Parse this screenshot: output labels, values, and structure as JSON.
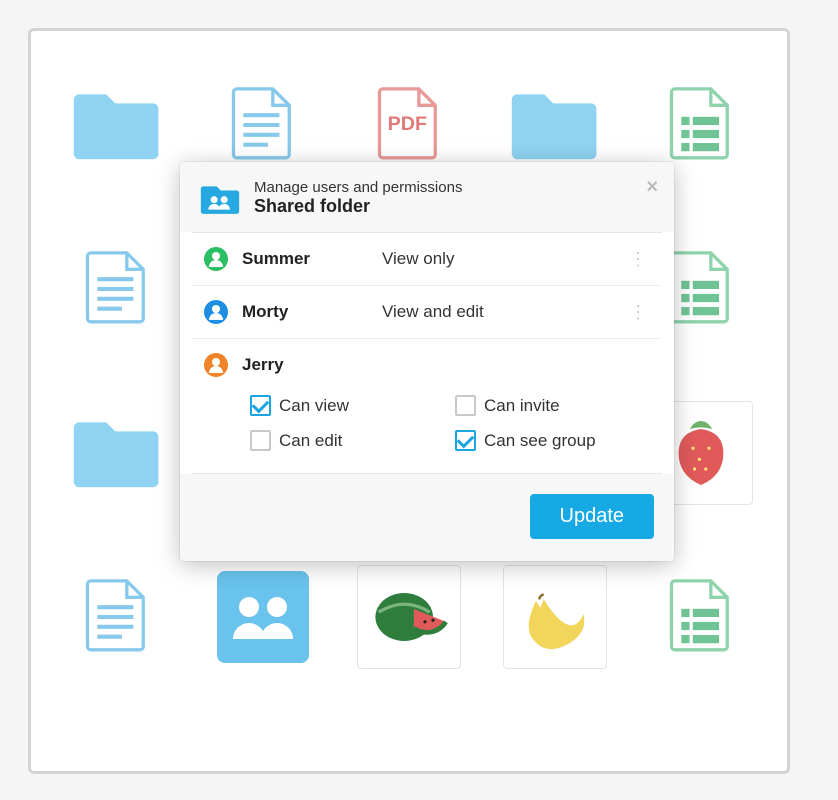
{
  "modal": {
    "subtitle": "Manage users and permissions",
    "title": "Shared folder",
    "users": [
      {
        "name": "Summer",
        "permission": "View only",
        "avatar_color": "#2cbf64"
      },
      {
        "name": "Morty",
        "permission": "View and edit",
        "avatar_color": "#1e8fe0"
      }
    ],
    "expanded_user": {
      "name": "Jerry",
      "avatar_color": "#f08327"
    },
    "options": {
      "can_view": {
        "label": "Can view",
        "checked": true
      },
      "can_invite": {
        "label": "Can invite",
        "checked": false
      },
      "can_edit": {
        "label": "Can edit",
        "checked": false
      },
      "can_group": {
        "label": "Can see group",
        "checked": true
      }
    },
    "update_label": "Update"
  },
  "background_items": [
    {
      "type": "folder"
    },
    {
      "type": "doc-blue"
    },
    {
      "type": "pdf"
    },
    {
      "type": "folder"
    },
    {
      "type": "list-green"
    },
    {
      "type": "doc-blue"
    },
    {
      "type": "blank"
    },
    {
      "type": "blank"
    },
    {
      "type": "blank"
    },
    {
      "type": "list-green"
    },
    {
      "type": "folder"
    },
    {
      "type": "blank"
    },
    {
      "type": "blank"
    },
    {
      "type": "blank"
    },
    {
      "type": "strawberry"
    },
    {
      "type": "doc-blue"
    },
    {
      "type": "shared-folder"
    },
    {
      "type": "watermelon"
    },
    {
      "type": "banana"
    },
    {
      "type": "list-green"
    }
  ],
  "pdf_label": "PDF"
}
